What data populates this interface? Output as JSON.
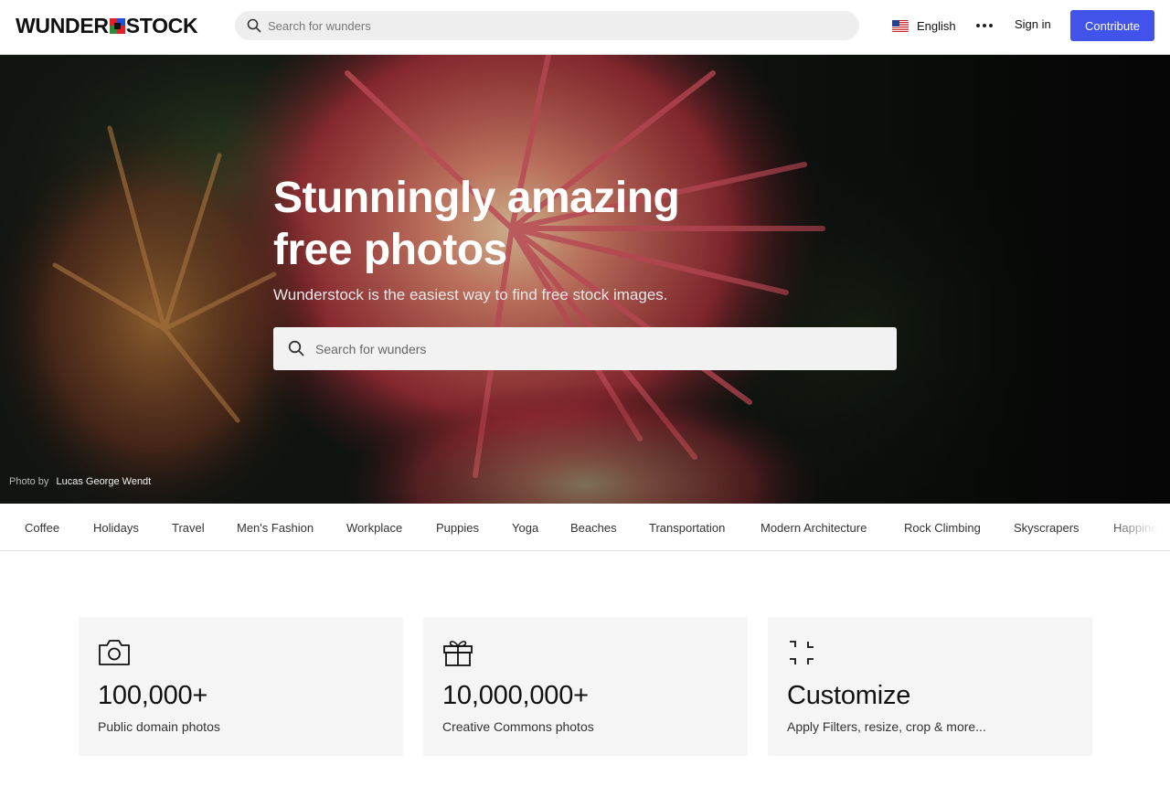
{
  "header": {
    "logo_left": "WUNDER",
    "logo_right": "STOCK",
    "search_placeholder": "Search for wunders",
    "language": "English",
    "language_flag": "us-flag",
    "more_icon": "more-horizontal-icon",
    "signin_label": "Sign in",
    "contribute_label": "Contribute",
    "accent_color": "#4253ec"
  },
  "hero": {
    "title": "Stunningly amazing free photos",
    "subtitle": "Wunderstock is the easiest way to find free stock images.",
    "search_placeholder": "Search for wunders",
    "credit_prefix": "Photo by",
    "credit_name": "Lucas George Wendt"
  },
  "categories": [
    "Coffee",
    "Holidays",
    "Travel",
    "Men's Fashion",
    "Workplace",
    "Puppies",
    "Yoga",
    "Beaches",
    "Transportation",
    "Modern Architecture",
    "Rock Climbing",
    "Skyscrapers",
    "Happiness"
  ],
  "features": [
    {
      "icon": "camera-icon",
      "value": "100,000+",
      "label": "Public domain photos"
    },
    {
      "icon": "gift-icon",
      "value": "10,000,000+",
      "label": "Creative Commons photos"
    },
    {
      "icon": "minimize-icon",
      "value": "Customize",
      "label": "Apply Filters, resize, crop & more..."
    }
  ]
}
